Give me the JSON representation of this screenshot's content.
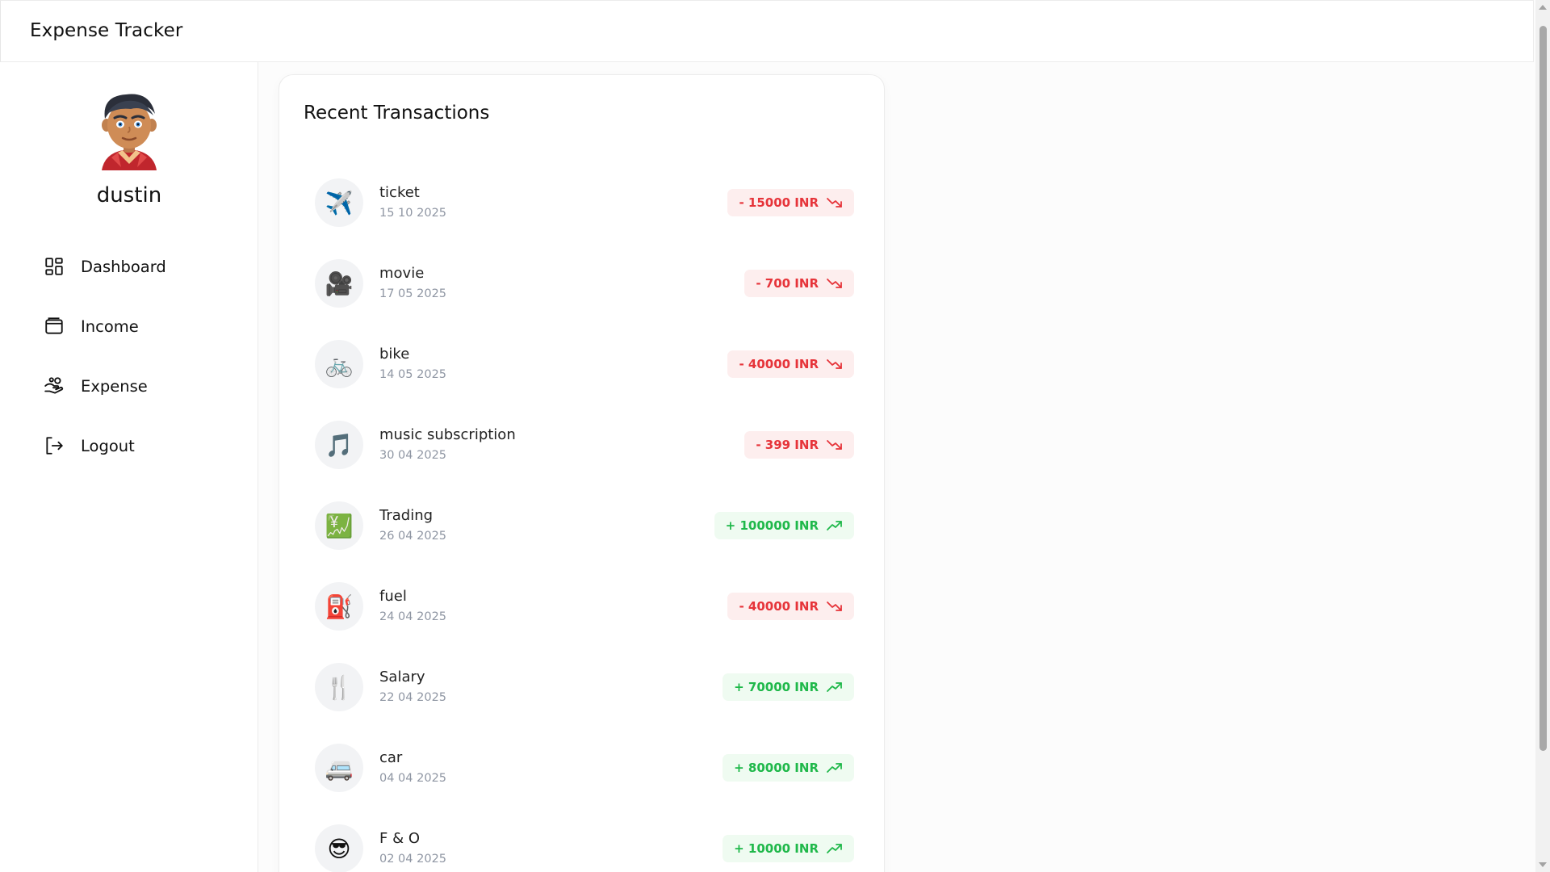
{
  "app": {
    "title": "Expense Tracker"
  },
  "user": {
    "name": "dustin"
  },
  "sidebar": {
    "items": [
      {
        "label": "Dashboard",
        "icon": "dashboard-icon"
      },
      {
        "label": "Income",
        "icon": "wallet-icon"
      },
      {
        "label": "Expense",
        "icon": "hand-coins-icon"
      },
      {
        "label": "Logout",
        "icon": "logout-icon"
      }
    ]
  },
  "recent": {
    "title": "Recent Transactions",
    "transactions": [
      {
        "emoji": "✈️",
        "name": "ticket",
        "date": "15 10 2025",
        "amount": "- 15000 INR",
        "type": "expense"
      },
      {
        "emoji": "🎥",
        "name": "movie",
        "date": "17 05 2025",
        "amount": "- 700 INR",
        "type": "expense"
      },
      {
        "emoji": "🚲",
        "name": "bike",
        "date": "14 05 2025",
        "amount": "- 40000 INR",
        "type": "expense"
      },
      {
        "emoji": "🎵",
        "name": "music subscription",
        "date": "30 04 2025",
        "amount": "- 399 INR",
        "type": "expense"
      },
      {
        "emoji": "💹",
        "name": "Trading",
        "date": "26 04 2025",
        "amount": "+ 100000 INR",
        "type": "income"
      },
      {
        "emoji": "⛽",
        "name": "fuel",
        "date": "24 04 2025",
        "amount": "- 40000 INR",
        "type": "expense"
      },
      {
        "emoji": "🍴",
        "name": "Salary",
        "date": "22 04 2025",
        "amount": "+ 70000 INR",
        "type": "income"
      },
      {
        "emoji": "🚐",
        "name": "car",
        "date": "04 04 2025",
        "amount": "+ 80000 INR",
        "type": "income"
      },
      {
        "emoji": "😎",
        "name": "F & O",
        "date": "02 04 2025",
        "amount": "+ 10000 INR",
        "type": "income"
      }
    ]
  },
  "colors": {
    "expense": "#e6343a",
    "expense_bg": "#fdeeee",
    "income": "#1fb84a",
    "income_bg": "#effbf1"
  }
}
